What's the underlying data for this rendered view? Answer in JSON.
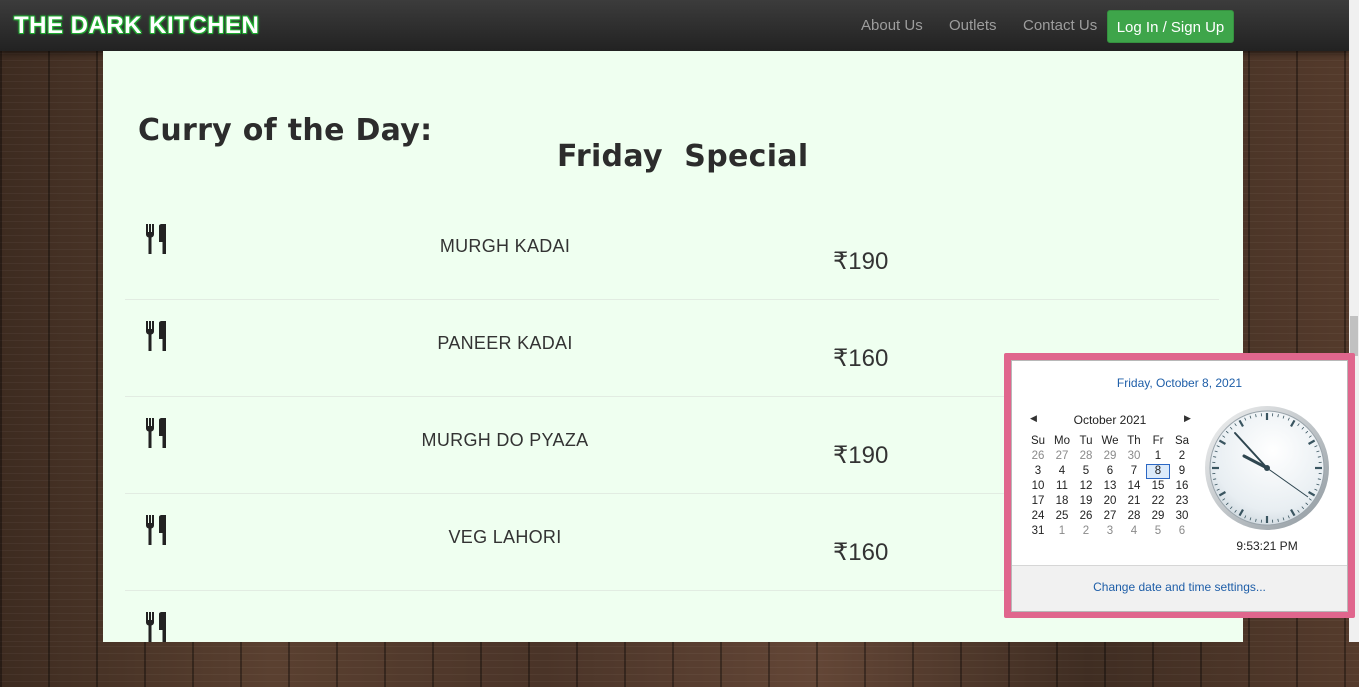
{
  "navbar": {
    "brand": "THE DARK KITCHEN",
    "links": [
      "About Us",
      "Outlets",
      "Contact Us"
    ],
    "login_label": "Log In / Sign Up"
  },
  "main": {
    "title": "Curry of the Day:",
    "subtitle": "Friday  Special",
    "items": [
      {
        "name": "MURGH KADAI",
        "price": "₹190",
        "icon": "cutlery-icon"
      },
      {
        "name": "PANEER KADAI",
        "price": "₹160",
        "icon": "cutlery-icon"
      },
      {
        "name": "MURGH DO PYAZA",
        "price": "₹190",
        "icon": "cutlery-icon"
      },
      {
        "name": "VEG LAHORI",
        "price": "₹160",
        "icon": "cutlery-icon"
      }
    ]
  },
  "popup": {
    "full_date": "Friday, October 8, 2021",
    "month": "October 2021",
    "weekdays": [
      "Su",
      "Mo",
      "Tu",
      "We",
      "Th",
      "Fr",
      "Sa"
    ],
    "weeks": [
      [
        "26",
        "27",
        "28",
        "29",
        "30",
        "1",
        "2"
      ],
      [
        "3",
        "4",
        "5",
        "6",
        "7",
        "8",
        "9"
      ],
      [
        "10",
        "11",
        "12",
        "13",
        "14",
        "15",
        "16"
      ],
      [
        "17",
        "18",
        "19",
        "20",
        "21",
        "22",
        "23"
      ],
      [
        "24",
        "25",
        "26",
        "27",
        "28",
        "29",
        "30"
      ],
      [
        "31",
        "1",
        "2",
        "3",
        "4",
        "5",
        "6"
      ]
    ],
    "selected_day": "8",
    "time": "9:53:21 PM",
    "change_link": "Change date and time settings..."
  },
  "colors": {
    "brand_glow": "#2ecc40",
    "login_button": "#3ea54a",
    "panel_background": "#effff0",
    "popup_border": "#e0668d",
    "link_blue": "#1e5ea8"
  }
}
